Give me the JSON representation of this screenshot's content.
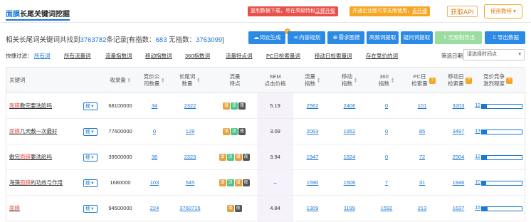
{
  "header": {
    "title_highlight": "面膜",
    "title_rest": "长尾关键词挖掘",
    "notice_red_text": "复制数据下载，尽在高级特权",
    "notice_red_link": "立即升级",
    "notice_orange_text": "开通企业版可享无限使用，",
    "notice_orange_link": "去开通",
    "api_label": "获取API",
    "help_label": "使用教程 ▾"
  },
  "summary": {
    "prefix": "相关长尾词关键词共找到",
    "total": "3763782",
    "mid1": "条记录[有指数：",
    "indexed": "683",
    "mid2": "无指数：",
    "unindexed": "3763099",
    "suffix": "]"
  },
  "actions": [
    {
      "label": "词云生成",
      "icon": "☁",
      "style": "blue"
    },
    {
      "label": "内容规划",
      "icon": "⋖",
      "style": "blue"
    },
    {
      "label": "需求图谱",
      "icon": "⊕",
      "style": "blue"
    },
    {
      "label": "高频词提取",
      "icon": "",
      "style": "blue"
    },
    {
      "label": "疑问词提取",
      "icon": "",
      "style": "blue"
    },
    {
      "label": "无限制导出",
      "icon": "⇩",
      "style": "green"
    },
    {
      "label": "导出数据",
      "icon": "⇩",
      "style": "blue"
    }
  ],
  "filters": {
    "label": "快捷过滤：",
    "items": [
      "所有词",
      "所有流量词",
      "流量指数词",
      "移动指数词",
      "360指数词",
      "流量特点词",
      "PC日检索量词",
      "移动日检索量词",
      "存在竞价的词"
    ]
  },
  "date_filter": {
    "label": "筛选日期：",
    "placeholder": "请选择时间点"
  },
  "table": {
    "headers": {
      "keyword": "关键词",
      "volume": "收录量",
      "bid_count": [
        "竞价公",
        "司数量"
      ],
      "longtail": [
        "长尾词",
        "数量"
      ],
      "traffic_feature": [
        "流量",
        "特点"
      ],
      "sem": [
        "SEM",
        "点击价格"
      ],
      "traffic_index": [
        "流量",
        "指数"
      ],
      "mobile_index": [
        "移动",
        "指数"
      ],
      "index_360": [
        "360",
        "指数"
      ],
      "pc_daily": [
        "PC日",
        "检索量"
      ],
      "mobile_daily": [
        "移动日",
        "检索量"
      ],
      "competition": [
        "竞价竞争",
        "激烈程度"
      ]
    },
    "search_btn_label": "搜",
    "tag_labels": {
      "q": "潜",
      "l": "流",
      "y": "夜"
    },
    "rows": [
      {
        "kw_hl": "面膜",
        "kw_rest": "教完要洗脸吗",
        "kw_hl_pos": "start",
        "volume": "68100000",
        "bids": "34",
        "longtail": "2322",
        "tags": [
          "q",
          "l",
          "y"
        ],
        "sem": "5.19",
        "traffic": "2562",
        "mobile": "2406",
        "i360": "0",
        "pc": "101",
        "mobile_daily": "3203",
        "comp": 12,
        "comp_fill": 0.12
      },
      {
        "kw_hl": "面膜",
        "kw_rest": "几天敷一次最好",
        "kw_hl_pos": "start",
        "volume": "77600000",
        "bids": "0",
        "longtail": "128",
        "tags": [
          "q",
          "l",
          "y"
        ],
        "sem": "3.09",
        "traffic": "2063",
        "mobile": "1952",
        "i360": "0",
        "pc": "85",
        "mobile_daily": "3497",
        "comp": 13,
        "comp_fill": 0.13
      },
      {
        "kw_pre": "敷完",
        "kw_hl": "面膜",
        "kw_rest": "要洗脸吗",
        "kw_hl_pos": "mid",
        "volume": "39500000",
        "bids": "38",
        "longtail": "2323",
        "tags": [
          "q",
          "l",
          "q",
          "y"
        ],
        "sem": "3.94",
        "traffic": "1947",
        "mobile": "1824",
        "i360": "0",
        "pc": "72",
        "mobile_daily": "2504",
        "comp": 12,
        "comp_fill": 0.12
      },
      {
        "kw_pre": "海藻",
        "kw_hl": "面膜",
        "kw_rest": "的功效与作用",
        "kw_hl_pos": "mid",
        "volume": "1680000",
        "bids": "103",
        "longtail": "545",
        "tags": [
          "q",
          "l",
          "q",
          "y"
        ],
        "sem": "–",
        "traffic": "1590",
        "mobile": "1506",
        "i360": "7",
        "pc": "31",
        "mobile_daily": "1946",
        "comp": 10,
        "comp_fill": 0.1
      },
      {
        "kw_hl": "面膜",
        "kw_rest": "",
        "kw_hl_pos": "start",
        "volume": "94500000",
        "bids": "224",
        "longtail": "3760715",
        "tags": [
          "q",
          "y"
        ],
        "sem": "4.84",
        "traffic": "1309",
        "mobile": "1199",
        "i360": "1592",
        "pc": "213",
        "mobile_daily": "1637",
        "comp": 15,
        "comp_fill": 0.15
      }
    ]
  },
  "colors": {
    "accent": "#1a78d6",
    "red": "#e8514a",
    "orange": "#f5a623",
    "green": "#9bdc9f"
  }
}
